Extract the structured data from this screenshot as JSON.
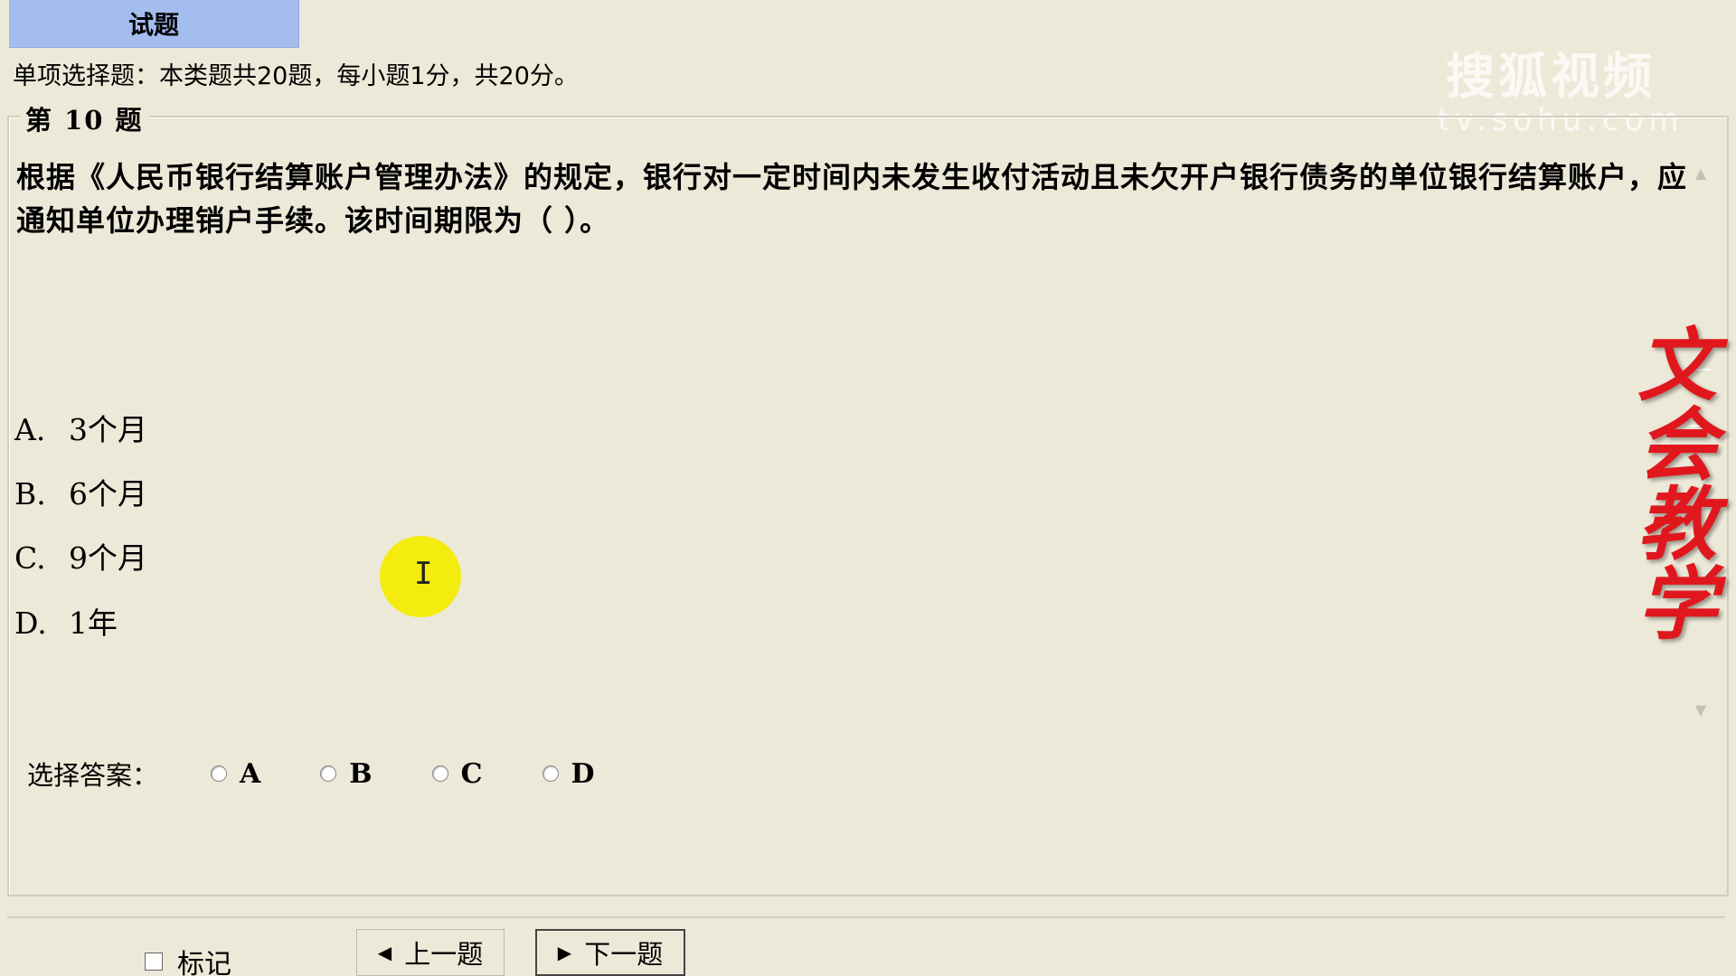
{
  "header": {
    "tab_label": "试题"
  },
  "instruction": "单项选择题：本类题共20题，每小题1分，共20分。",
  "watermark": {
    "title": "搜狐视频",
    "domain": "tv.sohu.com"
  },
  "question": {
    "legend": "第 10 题",
    "text": "根据《人民币银行结算账户管理办法》的规定，银行对一定时间内未发生收付活动且未欠开户银行债务的单位银行结算账户，应通知单位办理销户手续。该时间期限为（ ）。",
    "options": [
      {
        "letter": "A.",
        "text": "3个月"
      },
      {
        "letter": "B.",
        "text": "6个月"
      },
      {
        "letter": "C.",
        "text": "9个月"
      },
      {
        "letter": "D.",
        "text": "1年"
      }
    ]
  },
  "answer": {
    "label": "选择答案：",
    "choices": [
      "A",
      "B",
      "C",
      "D"
    ]
  },
  "brand": {
    "text": [
      "文",
      "会",
      "教",
      "学"
    ]
  },
  "footer": {
    "mark_label": "标记",
    "prev_label": "上一题",
    "next_label": "下一题"
  },
  "icons": {
    "prev": "triangle-left-icon",
    "next": "triangle-right-icon",
    "scroll_up": "chevron-up-icon",
    "scroll_down": "chevron-down-icon"
  }
}
